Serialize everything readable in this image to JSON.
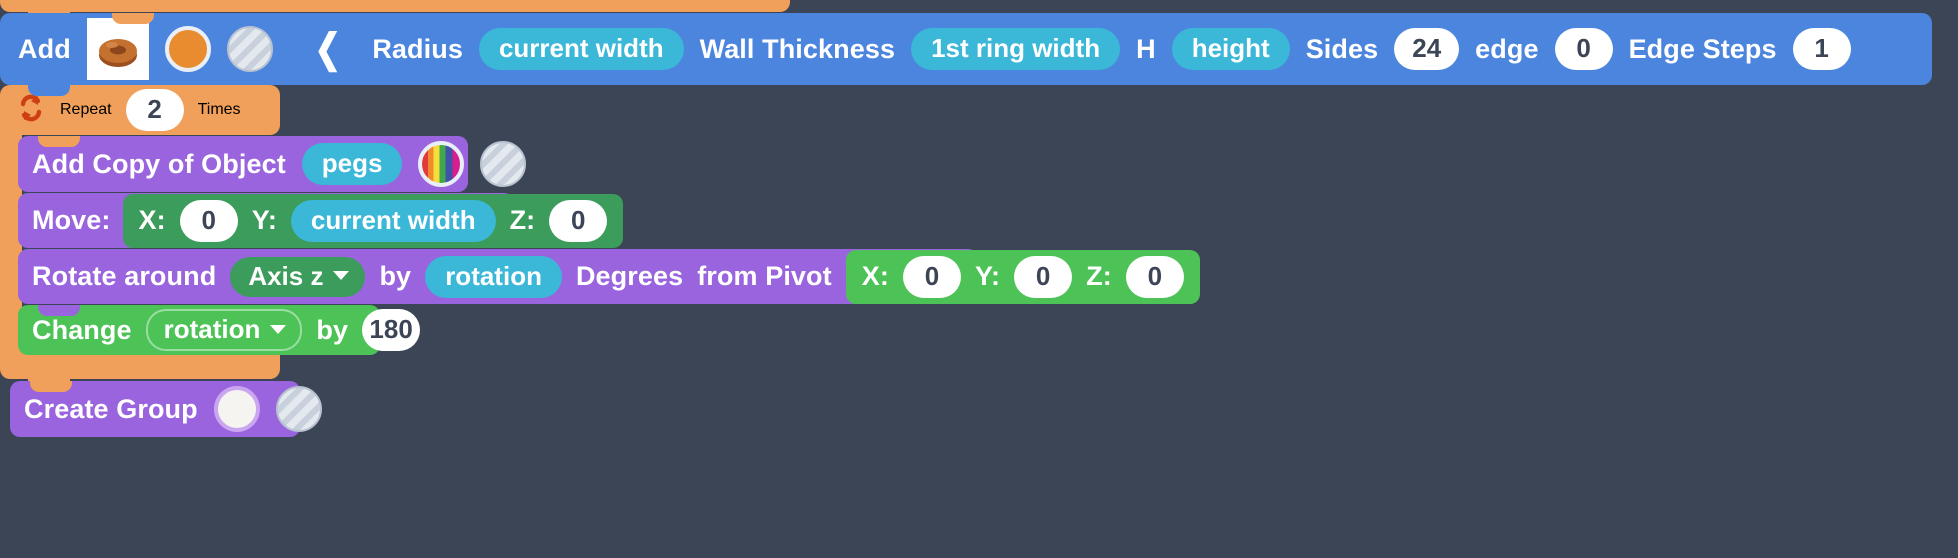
{
  "app": {
    "background_color": "#3b4556",
    "accent_colors": {
      "add_block": "#4c85de",
      "repeat_block": "#f0a05a",
      "object_block": "#9a64de",
      "move_block": "#3c9c5c",
      "change_block": "#4cc257",
      "variable_pill": "#3bb7d8",
      "input_pill": "#ffffff"
    }
  },
  "blocks": {
    "add": {
      "label": "Add",
      "object_thumbnail": "torus-thumbnail",
      "color_swatch": "orange-color-swatch",
      "material_swatch": "hatched-material-swatch",
      "collapse_icon": "chevron-left-icon",
      "fields": [
        {
          "label": "Radius",
          "value": "current width",
          "kind": "variable"
        },
        {
          "label": "Wall Thickness",
          "value": "1st ring width",
          "kind": "variable"
        },
        {
          "label": "H",
          "value": "height",
          "kind": "variable"
        },
        {
          "label": "Sides",
          "value": "24",
          "kind": "number"
        },
        {
          "label": "edge",
          "value": "0",
          "kind": "number"
        },
        {
          "label": "Edge Steps",
          "value": "1",
          "kind": "number"
        }
      ]
    },
    "repeat": {
      "icon": "loop-icon",
      "label": "Repeat",
      "count": "2",
      "suffix": "Times"
    },
    "add_copy": {
      "label": "Add Copy of Object",
      "object": "pegs",
      "color_swatch": "rainbow-color-swatch",
      "material_swatch": "hatched-material-swatch"
    },
    "move": {
      "label": "Move:",
      "axes": [
        {
          "label": "X:",
          "value": "0",
          "kind": "number"
        },
        {
          "label": "Y:",
          "value": "current width",
          "kind": "variable"
        },
        {
          "label": "Z:",
          "value": "0",
          "kind": "number"
        }
      ]
    },
    "rotate": {
      "label": "Rotate around",
      "axis": "Axis z",
      "by_label": "by",
      "amount": "rotation",
      "degrees_label": "Degrees",
      "pivot_label": "from Pivot",
      "pivot": [
        {
          "label": "X:",
          "value": "0"
        },
        {
          "label": "Y:",
          "value": "0"
        },
        {
          "label": "Z:",
          "value": "0"
        }
      ]
    },
    "change": {
      "label": "Change",
      "variable": "rotation",
      "by_label": "by",
      "value": "180"
    },
    "create_group": {
      "label": "Create Group",
      "color_swatch": "white-color-swatch",
      "material_swatch": "hatched-material-swatch"
    }
  }
}
